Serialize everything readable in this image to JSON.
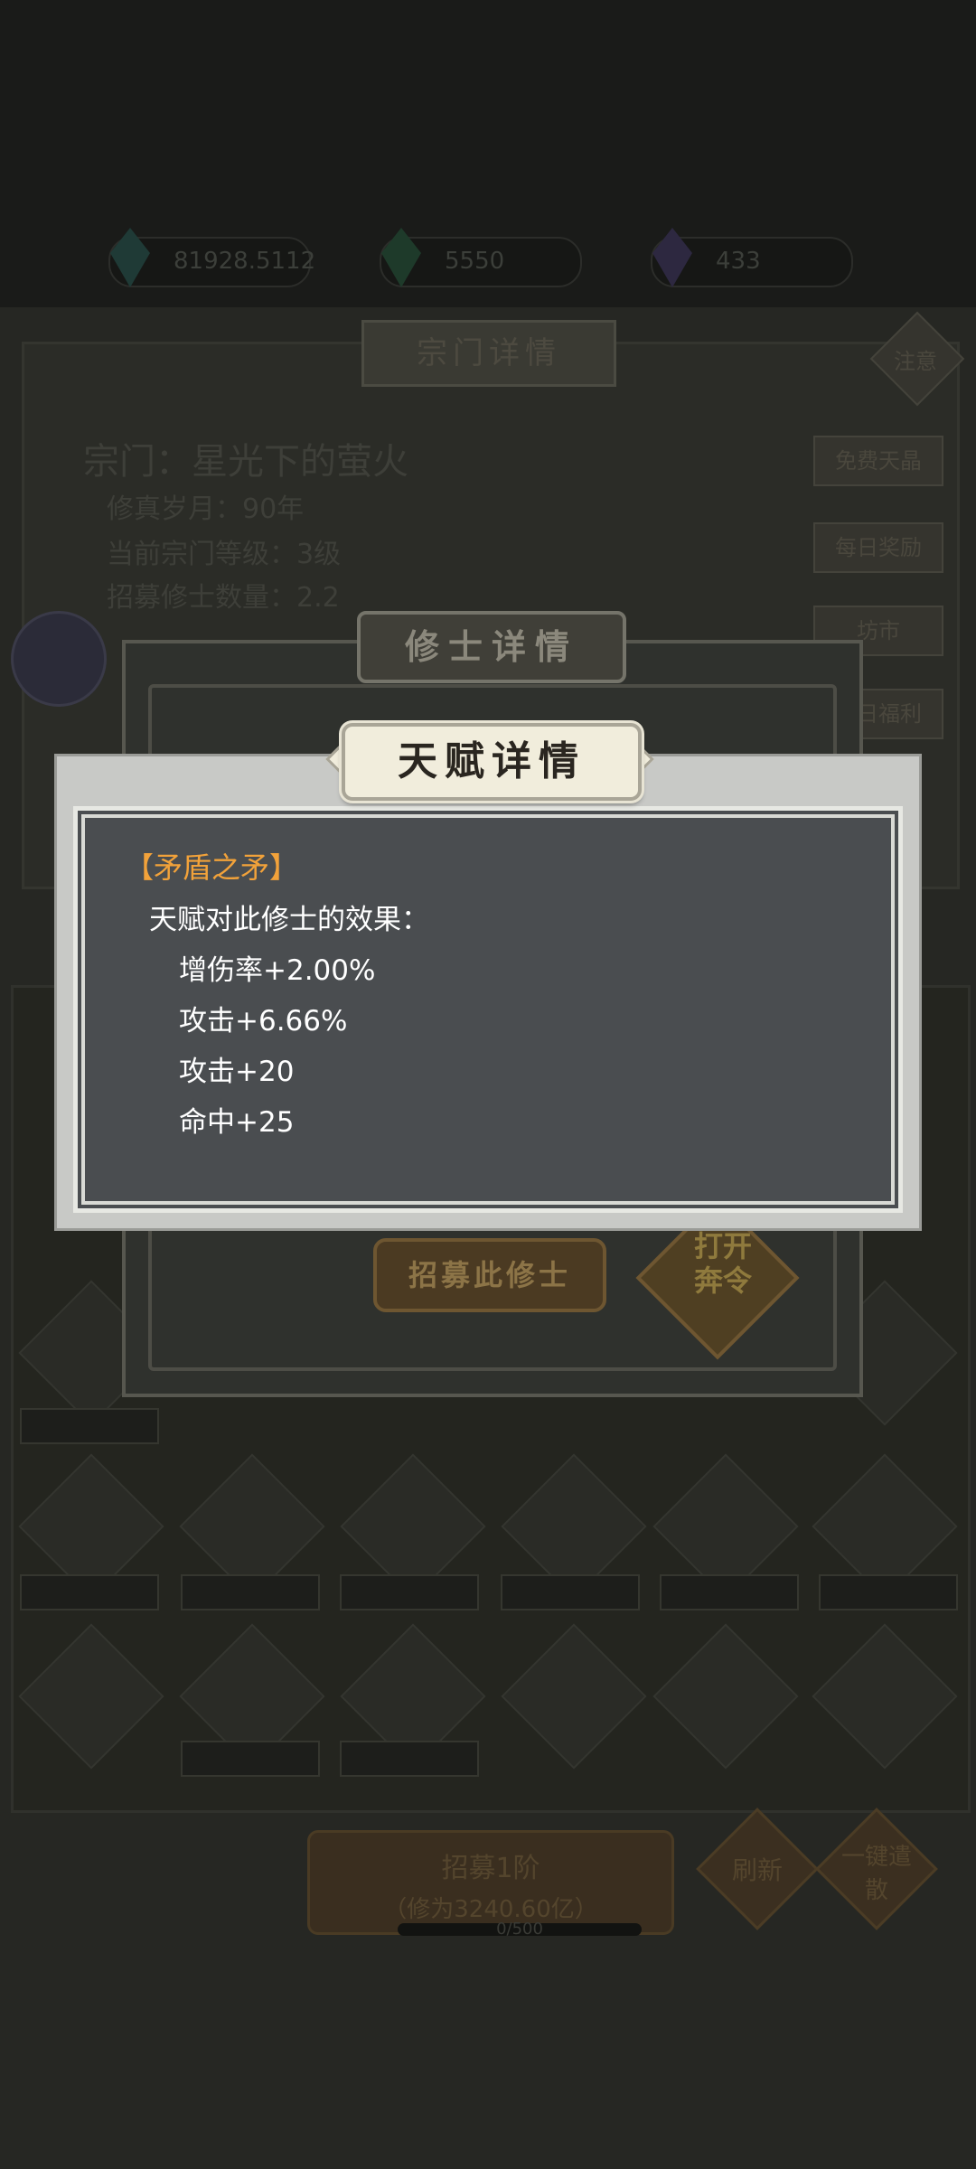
{
  "background": {
    "resources": [
      {
        "name": "spirit-stone",
        "value": "81928.5112"
      },
      {
        "name": "jade",
        "value": "5550"
      },
      {
        "name": "crystal",
        "value": "433"
      }
    ],
    "sect_panel": {
      "title": "宗门详情",
      "note_button": "注意",
      "sect_name": "宗门：星光下的萤火",
      "cultivation_years": "修真岁月：90年",
      "current_level": "当前宗门等级：3级",
      "disciple_count": "招募修士数量：2.2",
      "side_buttons": [
        "免费天晶",
        "每日奖励",
        "坊市",
        "每日福利"
      ]
    },
    "bottom": {
      "recruit_main": "招募1阶",
      "recruit_cost": "（修为3240.60亿）",
      "right_buttons": [
        "刷新",
        "一键遣散"
      ],
      "progress_text": "0/500"
    }
  },
  "cultivator_dialog": {
    "title": "修士详情",
    "recruit_button": "招募此修士",
    "fight_button": "打开\n奔令"
  },
  "talent_dialog": {
    "title": "天赋详情",
    "talent_name": "【矛盾之矛】",
    "effect_header": "天赋对此修士的效果：",
    "effects": [
      "增伤率+2.00%",
      "攻击+6.66%",
      "攻击+20",
      "命中+25"
    ]
  },
  "colors": {
    "talent_name": "#f2a23a",
    "effect_text": "#ffffff",
    "frame_fill": "#4a4d50",
    "dialog_outer": "#c8c9c6"
  }
}
